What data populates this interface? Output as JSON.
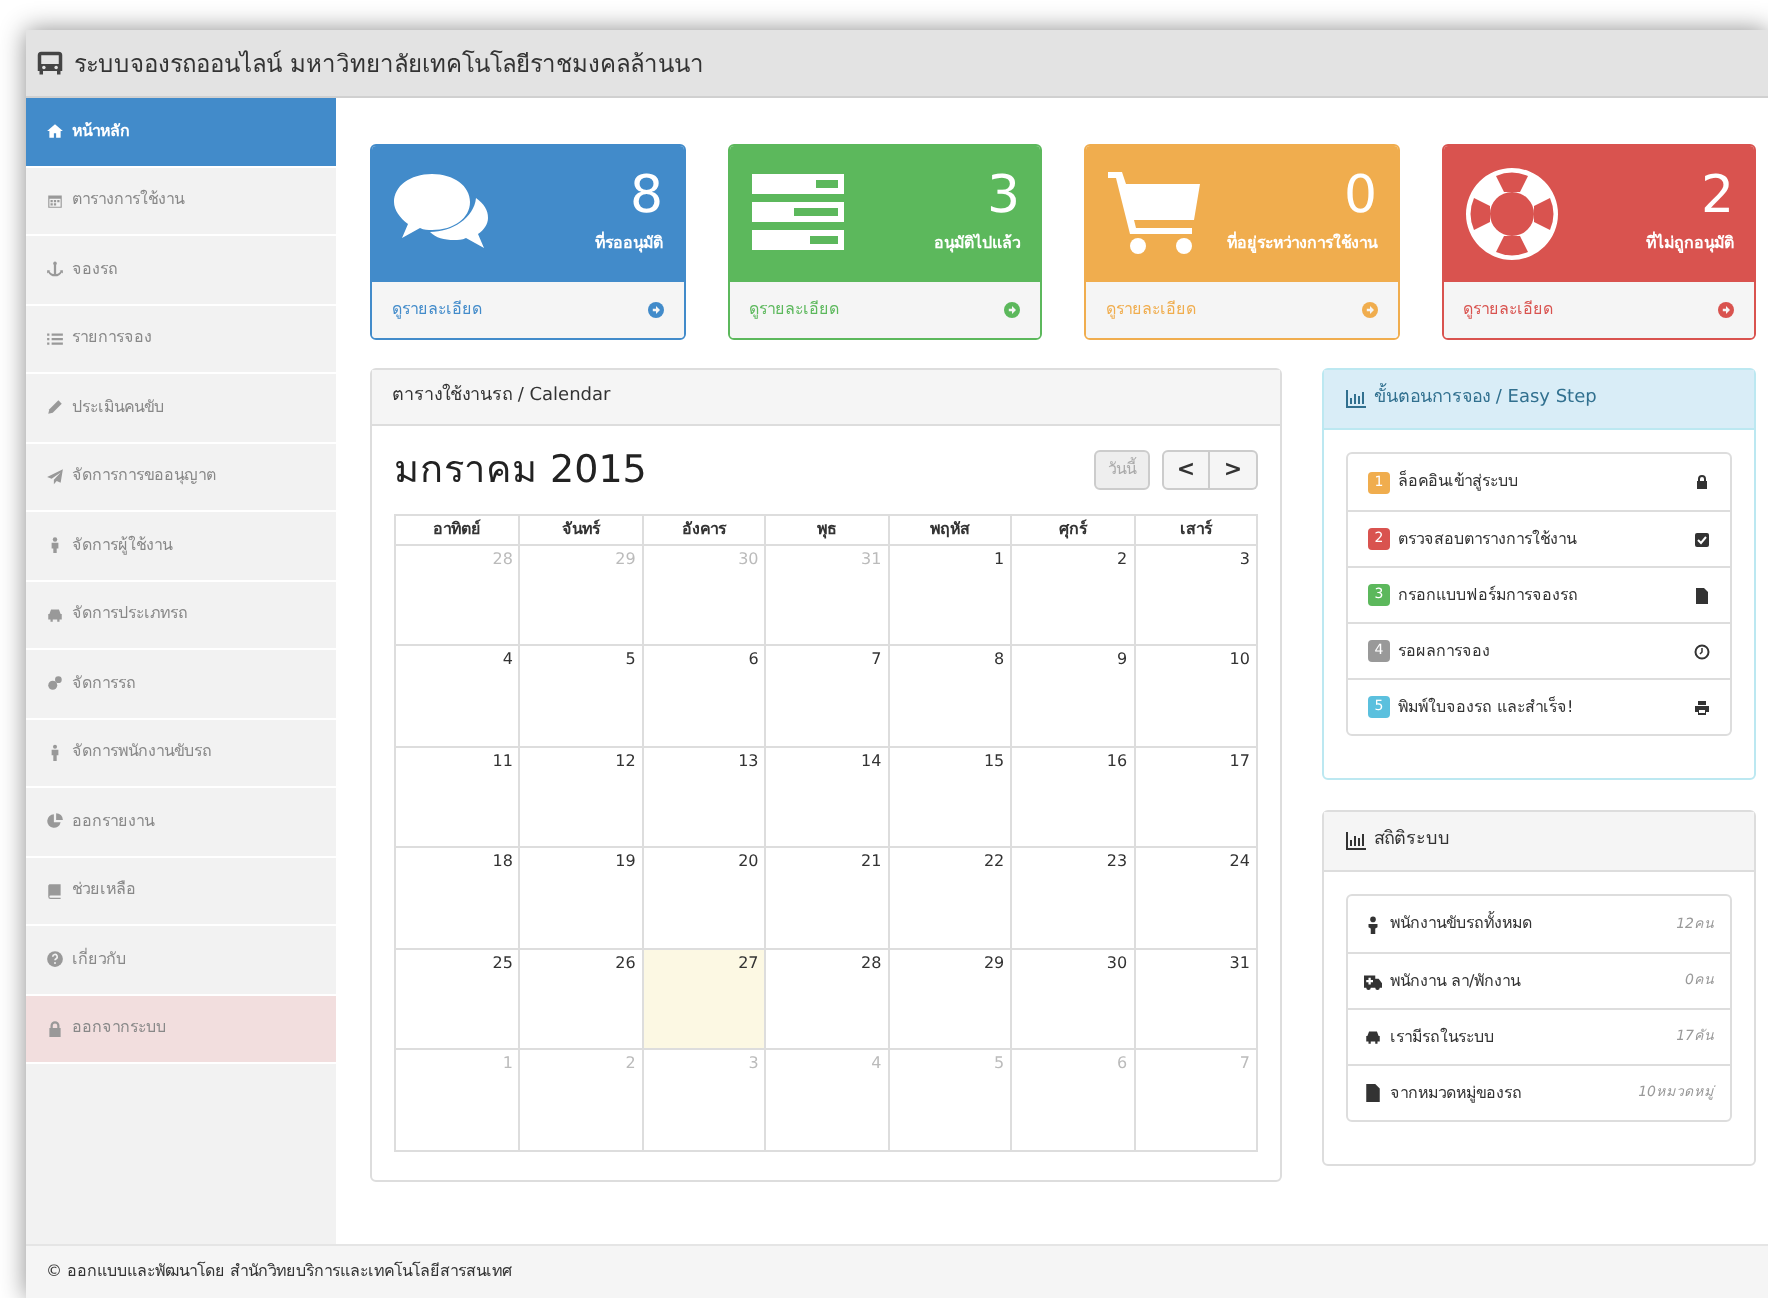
{
  "window": {
    "title": "ระบบจองรถออนไลน์ มหาวิทยาลัยเทคโนโลยีราชมงคลล้านนา"
  },
  "sidebar": {
    "items": [
      {
        "label": "หน้าหลัก",
        "selected": true,
        "kind": "link"
      },
      {
        "label": "ตารางการใช้งาน",
        "selected": false,
        "kind": "link"
      },
      {
        "label": "จองรถ",
        "selected": false,
        "kind": "link"
      },
      {
        "label": "รายการจอง",
        "selected": false,
        "kind": "link"
      },
      {
        "label": "ประเมินคนขับ",
        "selected": false,
        "kind": "link"
      },
      {
        "label": "จัดการการขออนุญาต",
        "selected": false,
        "kind": "link"
      },
      {
        "label": "จัดการผู้ใช้งาน",
        "selected": false,
        "kind": "link"
      },
      {
        "label": "จัดการประเภทรถ",
        "selected": false,
        "kind": "link"
      },
      {
        "label": "จัดการรถ",
        "selected": false,
        "kind": "link"
      },
      {
        "label": "จัดการพนักงานขับรถ",
        "selected": false,
        "kind": "link"
      },
      {
        "label": "ออกรายงาน",
        "selected": false,
        "kind": "link"
      },
      {
        "label": "ช่วยเหลือ",
        "selected": false,
        "kind": "link"
      },
      {
        "label": "เกี่ยวกับ",
        "selected": false,
        "kind": "link"
      },
      {
        "label": "ออกจากระบบ",
        "selected": false,
        "kind": "logout"
      }
    ]
  },
  "stat_cards": [
    {
      "count": "8",
      "label": "ที่รออนุมัติ",
      "link": "ดูรายละเอียด",
      "color": "#428bca"
    },
    {
      "count": "3",
      "label": "อนุมัติไปแล้ว",
      "link": "ดูรายละเอียด",
      "color": "#5cb85c"
    },
    {
      "count": "0",
      "label": "ที่อยู่ระหว่างการใช้งาน",
      "link": "ดูรายละเอียด",
      "color": "#f0ad4e"
    },
    {
      "count": "2",
      "label": "ที่ไม่ถูกอนุมัติ",
      "link": "ดูรายละเอียด",
      "color": "#d9534f"
    }
  ],
  "calendar": {
    "panel_title": "ตารางใช้งานรถ / Calendar",
    "month": "มกราคม 2015",
    "today_button": "วันนี้",
    "prev": "<",
    "next": ">",
    "weekdays": [
      "อาทิตย์",
      "จันทร์",
      "อังคาร",
      "พุธ",
      "พฤหัส",
      "ศุกร์",
      "เสาร์"
    ],
    "weeks": [
      [
        {
          "day": "28",
          "other_month": true,
          "today": false
        },
        {
          "day": "29",
          "other_month": true,
          "today": false
        },
        {
          "day": "30",
          "other_month": true,
          "today": false
        },
        {
          "day": "31",
          "other_month": true,
          "today": false
        },
        {
          "day": "1",
          "other_month": false,
          "today": false
        },
        {
          "day": "2",
          "other_month": false,
          "today": false
        },
        {
          "day": "3",
          "other_month": false,
          "today": false
        }
      ],
      [
        {
          "day": "4",
          "other_month": false,
          "today": false
        },
        {
          "day": "5",
          "other_month": false,
          "today": false
        },
        {
          "day": "6",
          "other_month": false,
          "today": false
        },
        {
          "day": "7",
          "other_month": false,
          "today": false
        },
        {
          "day": "8",
          "other_month": false,
          "today": false
        },
        {
          "day": "9",
          "other_month": false,
          "today": false
        },
        {
          "day": "10",
          "other_month": false,
          "today": false
        }
      ],
      [
        {
          "day": "11",
          "other_month": false,
          "today": false
        },
        {
          "day": "12",
          "other_month": false,
          "today": false
        },
        {
          "day": "13",
          "other_month": false,
          "today": false
        },
        {
          "day": "14",
          "other_month": false,
          "today": false
        },
        {
          "day": "15",
          "other_month": false,
          "today": false
        },
        {
          "day": "16",
          "other_month": false,
          "today": false
        },
        {
          "day": "17",
          "other_month": false,
          "today": false
        }
      ],
      [
        {
          "day": "18",
          "other_month": false,
          "today": false
        },
        {
          "day": "19",
          "other_month": false,
          "today": false
        },
        {
          "day": "20",
          "other_month": false,
          "today": false
        },
        {
          "day": "21",
          "other_month": false,
          "today": false
        },
        {
          "day": "22",
          "other_month": false,
          "today": false
        },
        {
          "day": "23",
          "other_month": false,
          "today": false
        },
        {
          "day": "24",
          "other_month": false,
          "today": false
        }
      ],
      [
        {
          "day": "25",
          "other_month": false,
          "today": false
        },
        {
          "day": "26",
          "other_month": false,
          "today": false
        },
        {
          "day": "27",
          "other_month": false,
          "today": true
        },
        {
          "day": "28",
          "other_month": false,
          "today": false
        },
        {
          "day": "29",
          "other_month": false,
          "today": false
        },
        {
          "day": "30",
          "other_month": false,
          "today": false
        },
        {
          "day": "31",
          "other_month": false,
          "today": false
        }
      ],
      [
        {
          "day": "1",
          "other_month": true,
          "today": false
        },
        {
          "day": "2",
          "other_month": true,
          "today": false
        },
        {
          "day": "3",
          "other_month": true,
          "today": false
        },
        {
          "day": "4",
          "other_month": true,
          "today": false
        },
        {
          "day": "5",
          "other_month": true,
          "today": false
        },
        {
          "day": "6",
          "other_month": true,
          "today": false
        },
        {
          "day": "7",
          "other_month": true,
          "today": false
        }
      ]
    ]
  },
  "steps": {
    "title": "ขั้นตอนการจอง / Easy Step",
    "items": [
      {
        "number": "1",
        "label": "ล็อคอินเข้าสู่ระบบ",
        "color": "#f0ad4e"
      },
      {
        "number": "2",
        "label": "ตรวจสอบตารางการใช้งาน",
        "color": "#d9534f"
      },
      {
        "number": "3",
        "label": "กรอกแบบฟอร์มการจองรถ",
        "color": "#5cb85c"
      },
      {
        "number": "4",
        "label": "รอผลการจอง",
        "color": "#999999"
      },
      {
        "number": "5",
        "label": "พิมพ์ใบจองรถ และสำเร็จ!",
        "color": "#5bc0de"
      }
    ]
  },
  "stats": {
    "title": "สถิติระบบ",
    "items": [
      {
        "label": "พนักงานขับรถทั้งหมด",
        "value": "12คน"
      },
      {
        "label": "พนักงาน ลา/พักงาน",
        "value": "0คน"
      },
      {
        "label": "เรามีรถในระบบ",
        "value": "17คัน"
      },
      {
        "label": "จากหมวดหมู่ของรถ",
        "value": "10หมวดหมู่"
      }
    ]
  },
  "footer": {
    "text": "© ออกแบบและพัฒนาโดย สำนักวิทยบริการและเทคโนโลยีสารสนเทศ"
  }
}
